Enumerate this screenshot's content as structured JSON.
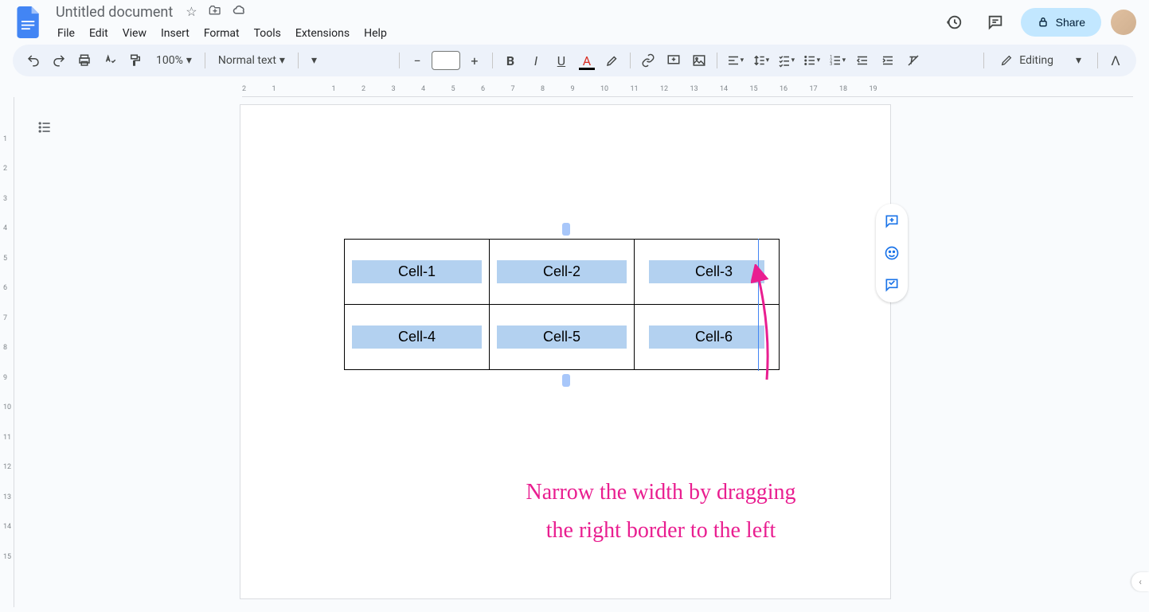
{
  "document": {
    "title": "Untitled document"
  },
  "menus": [
    "File",
    "Edit",
    "View",
    "Insert",
    "Format",
    "Tools",
    "Extensions",
    "Help"
  ],
  "share": {
    "label": "Share"
  },
  "toolbar": {
    "zoom": "100%",
    "style": "Normal text",
    "editing_label": "Editing"
  },
  "table": {
    "rows": [
      [
        "Cell-1",
        "Cell-2",
        "Cell-3"
      ],
      [
        "Cell-4",
        "Cell-5",
        "Cell-6"
      ]
    ]
  },
  "annotation": {
    "line1": "Narrow the width by dragging",
    "line2": "the right border to the left"
  },
  "ruler_h": [
    "2",
    "1",
    "",
    "1",
    "2",
    "3",
    "4",
    "5",
    "6",
    "7",
    "8",
    "9",
    "10",
    "11",
    "12",
    "13",
    "14",
    "15",
    "16",
    "17",
    "18",
    "19"
  ],
  "ruler_v": [
    "",
    "1",
    "2",
    "3",
    "4",
    "5",
    "6",
    "7",
    "8",
    "9",
    "10",
    "11",
    "12",
    "13",
    "14",
    "15"
  ]
}
